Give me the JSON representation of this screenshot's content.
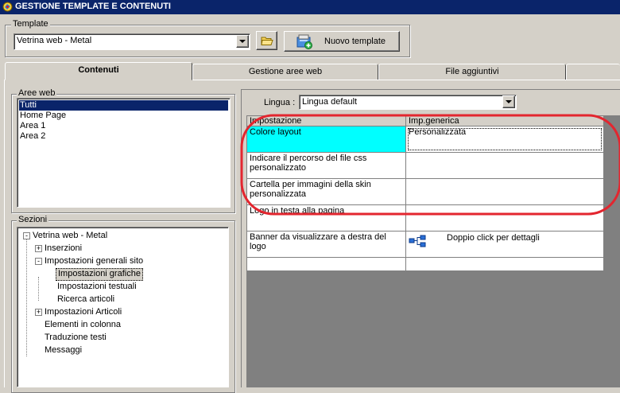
{
  "window": {
    "title": "GESTIONE TEMPLATE E CONTENUTI"
  },
  "template_group": {
    "label": "Template",
    "selected": "Vetrina web - Metal",
    "folder_icon": "folder-open-icon",
    "new_button_label": "Nuovo template",
    "new_button_icon": "new-template-icon"
  },
  "tabs": [
    {
      "label": "Contenuti",
      "active": true
    },
    {
      "label": "Gestione aree web",
      "active": false
    },
    {
      "label": "File aggiuntivi",
      "active": false
    }
  ],
  "aree_web": {
    "label": "Aree web",
    "items": [
      "Tutti",
      "Home Page",
      "Area 1",
      "Area 2"
    ],
    "selected_index": 0
  },
  "sezioni": {
    "label": "Sezioni",
    "nodes": [
      {
        "label": "Vetrina web - Metal",
        "level": 0,
        "toggle": "-"
      },
      {
        "label": "Inserzioni",
        "level": 1,
        "toggle": "+"
      },
      {
        "label": "Impostazioni generali sito",
        "level": 1,
        "toggle": "-"
      },
      {
        "label": "Impostazioni grafiche",
        "level": 2,
        "toggle": "",
        "selected": true
      },
      {
        "label": "Impostazioni testuali",
        "level": 2,
        "toggle": ""
      },
      {
        "label": "Ricerca articoli",
        "level": 2,
        "toggle": ""
      },
      {
        "label": "Impostazioni Articoli",
        "level": 1,
        "toggle": "+"
      },
      {
        "label": "Elementi in colonna",
        "level": 1,
        "toggle": ""
      },
      {
        "label": "Traduzione testi",
        "level": 1,
        "toggle": ""
      },
      {
        "label": "Messaggi",
        "level": 1,
        "toggle": ""
      }
    ]
  },
  "lingua": {
    "label": "Lingua :",
    "selected": "Lingua default"
  },
  "grid": {
    "headers": [
      "Impostazione",
      "Imp.generica"
    ],
    "rows": [
      {
        "setting": "Colore layout",
        "value": "Personalizzata",
        "highlight_color": "#00ffff"
      },
      {
        "setting": "Indicare il percorso del file css personalizzato",
        "value": ""
      },
      {
        "setting": "Cartella per immagini della skin personalizzata",
        "value": ""
      },
      {
        "setting": "Logo in testa alla pagina",
        "value": ""
      },
      {
        "setting": "Banner da visualizzare a destra del logo",
        "value": "Doppio click per dettagli",
        "value_icon": "tree-structure-icon"
      },
      {
        "setting": "",
        "value": ""
      }
    ]
  },
  "colors": {
    "annotation_red": "#e3262f",
    "selection_blue": "#0a246a",
    "grid_bg": "#808080",
    "cyan": "#00ffff"
  }
}
